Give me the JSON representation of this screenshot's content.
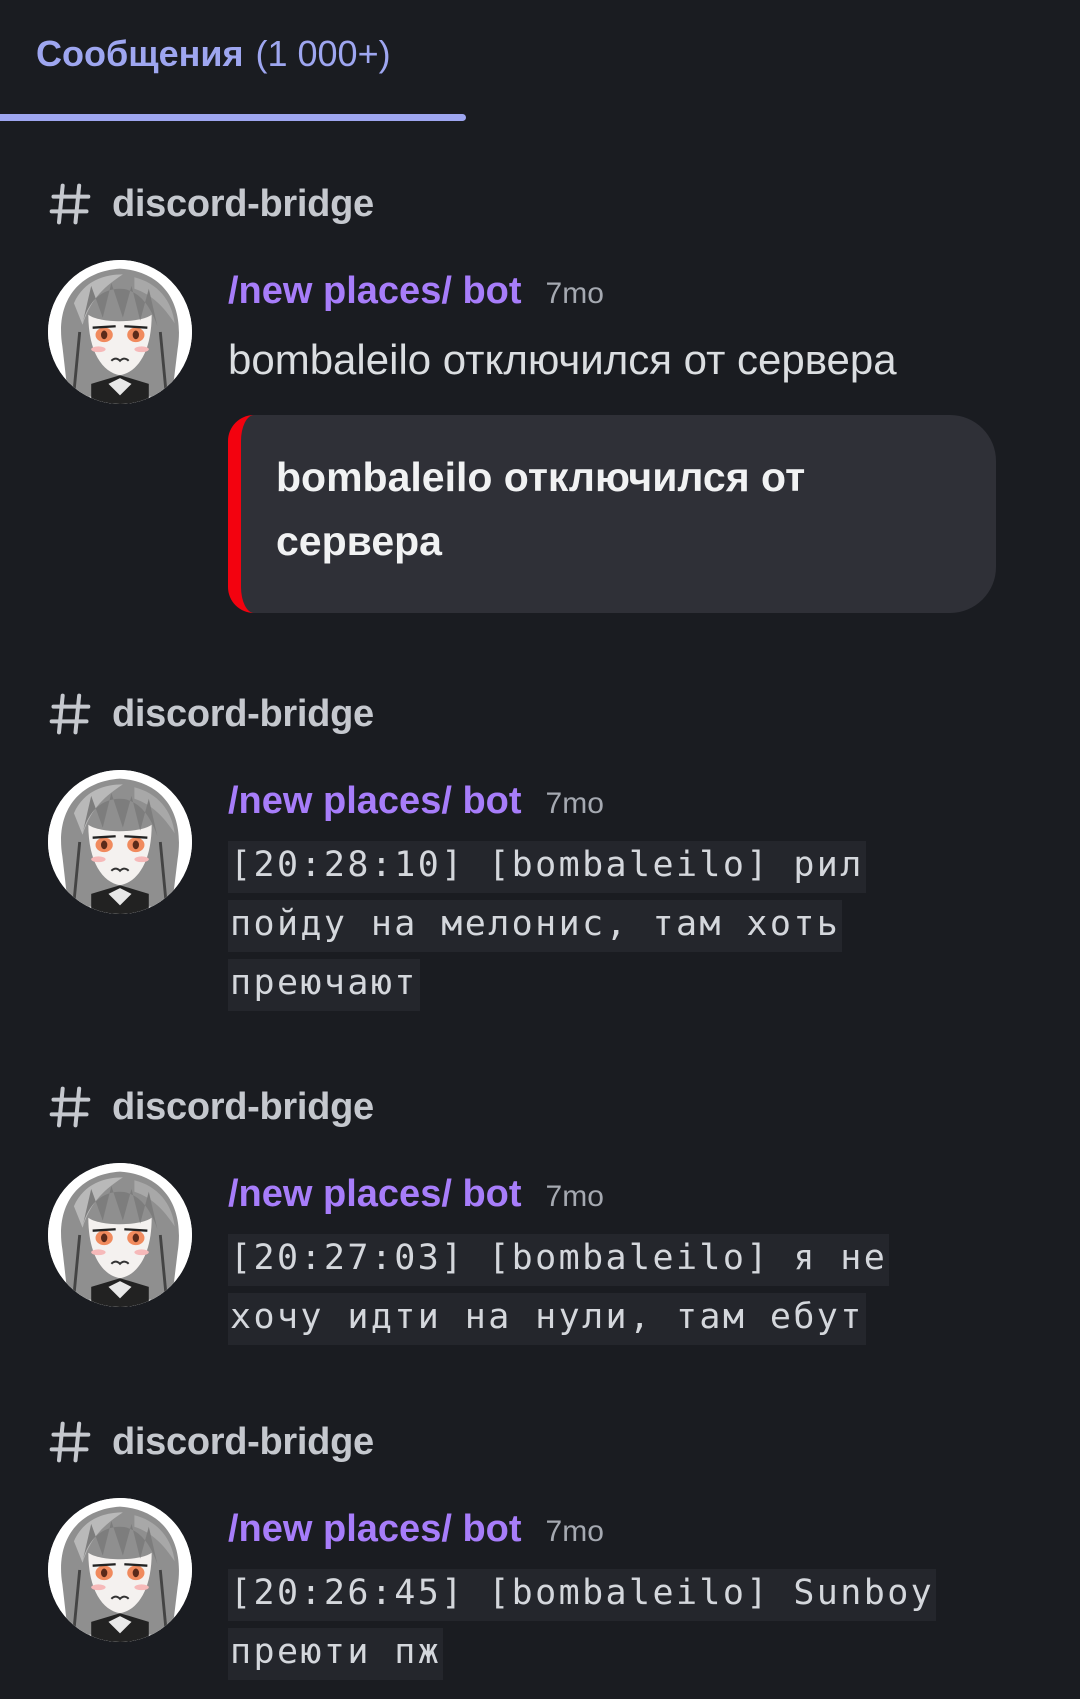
{
  "tabs": [
    {
      "label": "Сообщения",
      "count": "(1 000+)",
      "active": true
    }
  ],
  "colors": {
    "background": "#1a1c21",
    "accent": "#9ea6f0",
    "author": "#a77dfa",
    "embed_bar": "#f3020f"
  },
  "results": [
    {
      "channel": "discord-bridge",
      "author": "/new places/ bot",
      "time": "7mo",
      "text": "bombaleilo отключился от сервера",
      "embed_title": "bombaleilo отключился от сервера"
    },
    {
      "channel": "discord-bridge",
      "author": "/new places/ bot",
      "time": "7mo",
      "code": "[20:28:10] [bombaleilo] рил пойду на мелонис, там хоть преючают"
    },
    {
      "channel": "discord-bridge",
      "author": "/new places/ bot",
      "time": "7mo",
      "code": "[20:27:03] [bombaleilo] я не хочу идти на нули, там ебут"
    },
    {
      "channel": "discord-bridge",
      "author": "/new places/ bot",
      "time": "7mo",
      "code": "[20:26:45] [bombaleilo] Sunboy преюти пж"
    }
  ],
  "icons": {
    "channel": "hash-icon",
    "avatar": "anime-avatar"
  }
}
